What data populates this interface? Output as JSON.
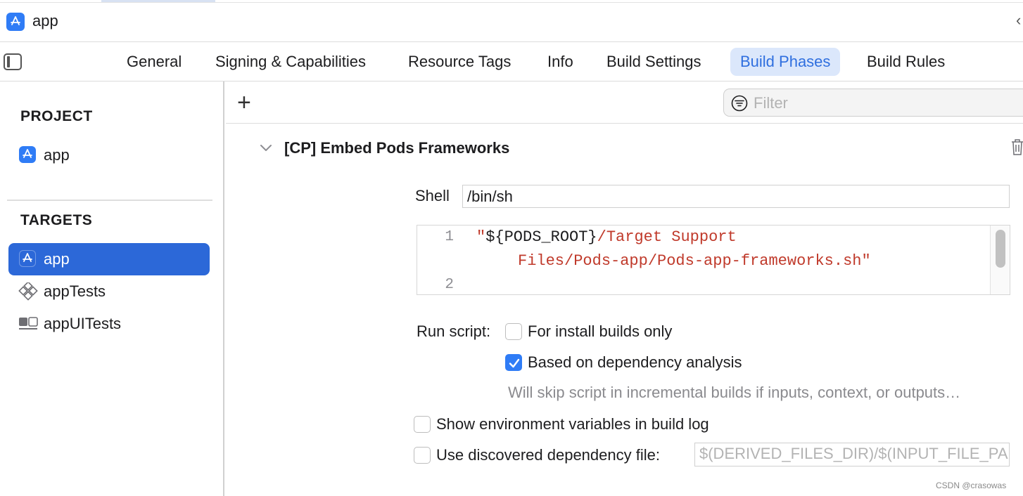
{
  "window": {
    "title": "app",
    "nav_glyph": "‹"
  },
  "tabs": [
    {
      "label": "General",
      "active": false
    },
    {
      "label": "Signing & Capabilities",
      "active": false
    },
    {
      "label": "Resource Tags",
      "active": false
    },
    {
      "label": "Info",
      "active": false
    },
    {
      "label": "Build Settings",
      "active": false
    },
    {
      "label": "Build Phases",
      "active": true
    },
    {
      "label": "Build Rules",
      "active": false
    }
  ],
  "sidebar": {
    "project_title": "PROJECT",
    "project_item": "app",
    "targets_title": "TARGETS",
    "targets": [
      {
        "label": "app",
        "selected": true,
        "icon": "app-store-icon"
      },
      {
        "label": "appTests",
        "selected": false,
        "icon": "unit-test-icon"
      },
      {
        "label": "appUITests",
        "selected": false,
        "icon": "ui-test-icon"
      }
    ]
  },
  "toolbar": {
    "add_glyph": "+",
    "filter_placeholder": "Filter"
  },
  "phase": {
    "title": "[CP] Embed Pods Frameworks",
    "shell_label": "Shell",
    "shell_value": "/bin/sh",
    "code": {
      "line_numbers": [
        "1",
        "2"
      ],
      "line1_quote": "\"",
      "line1_var": "${PODS_ROOT}",
      "line1_rest": "/Target Support",
      "line1_wrap": "Files/Pods-app/Pods-app-frameworks.sh\""
    },
    "run_script_label": "Run script:",
    "install_builds_label": "For install builds only",
    "install_builds_checked": false,
    "dependency_label": "Based on dependency analysis",
    "dependency_checked": true,
    "dependency_hint": "Will skip script in incremental builds if inputs, context, or outputs…",
    "show_env_label": "Show environment variables in build log",
    "show_env_checked": false,
    "discovered_dep_label": "Use discovered dependency file:",
    "discovered_dep_checked": false,
    "discovered_dep_placeholder": "$(DERIVED_FILES_DIR)/$(INPUT_FILE_PA"
  },
  "watermark": "CSDN @crasowas",
  "colors": {
    "accent": "#2f7cf6",
    "selection": "#2c68d8",
    "active_tab_bg": "#dbe7fb",
    "string": "#c03a2b"
  }
}
